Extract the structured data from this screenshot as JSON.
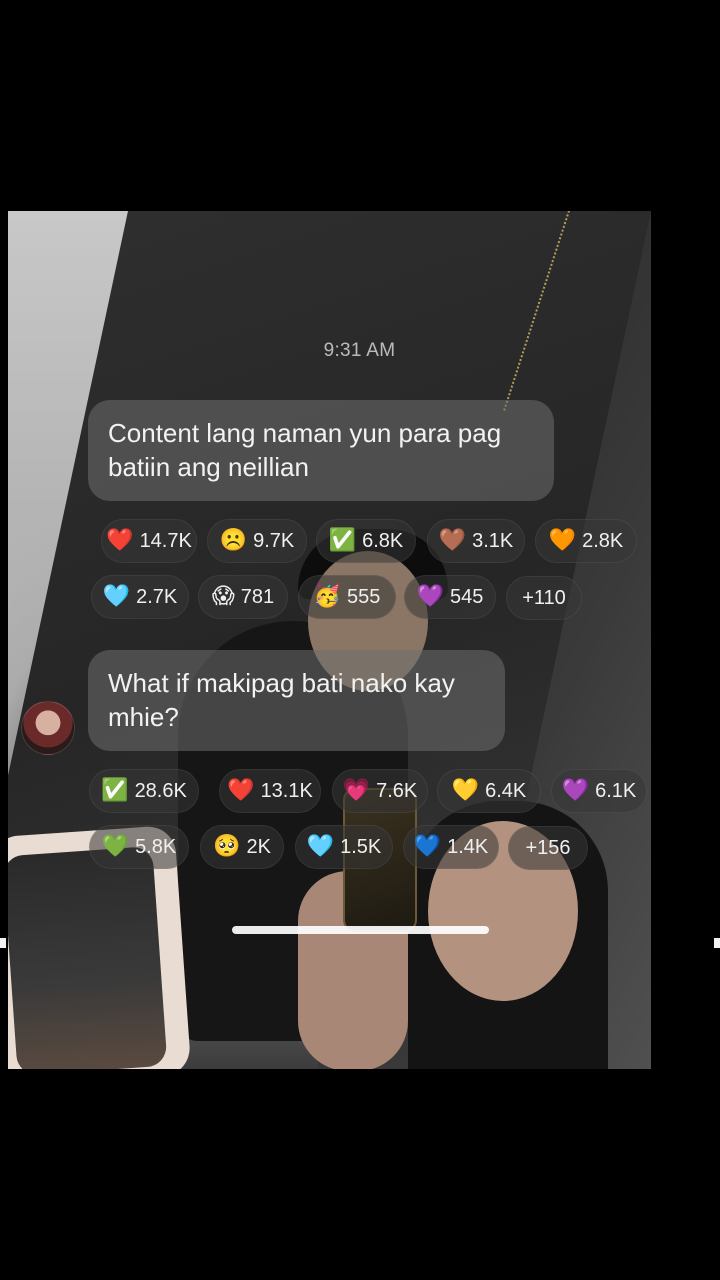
{
  "chat": {
    "timestamp": "9:31 AM",
    "messages": [
      {
        "text_line1": "Content lang naman yun para pag",
        "text_line2": "batiin ang neillian",
        "reactions": [
          {
            "emoji": "❤️",
            "count": "14.7K"
          },
          {
            "emoji": "☹️",
            "count": "9.7K"
          },
          {
            "emoji": "✅",
            "count": "6.8K"
          },
          {
            "emoji": "🤎",
            "count": "3.1K"
          },
          {
            "emoji": "🧡",
            "count": "2.8K"
          },
          {
            "emoji": "🩵",
            "count": "2.7K"
          },
          {
            "emoji": "😱",
            "count": "781"
          },
          {
            "emoji": "🥳",
            "count": "555"
          },
          {
            "emoji": "💜",
            "count": "545"
          },
          {
            "emoji": "",
            "count": "+110"
          }
        ]
      },
      {
        "text_line1": "What if makipag bati nako kay",
        "text_line2": "mhie?",
        "reactions": [
          {
            "emoji": "✅",
            "count": "28.6K"
          },
          {
            "emoji": "❤️",
            "count": "13.1K"
          },
          {
            "emoji": "💗",
            "count": "7.6K"
          },
          {
            "emoji": "💛",
            "count": "6.4K"
          },
          {
            "emoji": "💜",
            "count": "6.1K"
          },
          {
            "emoji": "💚",
            "count": "5.8K"
          },
          {
            "emoji": "🥺",
            "count": "2K"
          },
          {
            "emoji": "🩵",
            "count": "1.5K"
          },
          {
            "emoji": "💙",
            "count": "1.4K"
          },
          {
            "emoji": "",
            "count": "+156"
          }
        ]
      }
    ]
  }
}
